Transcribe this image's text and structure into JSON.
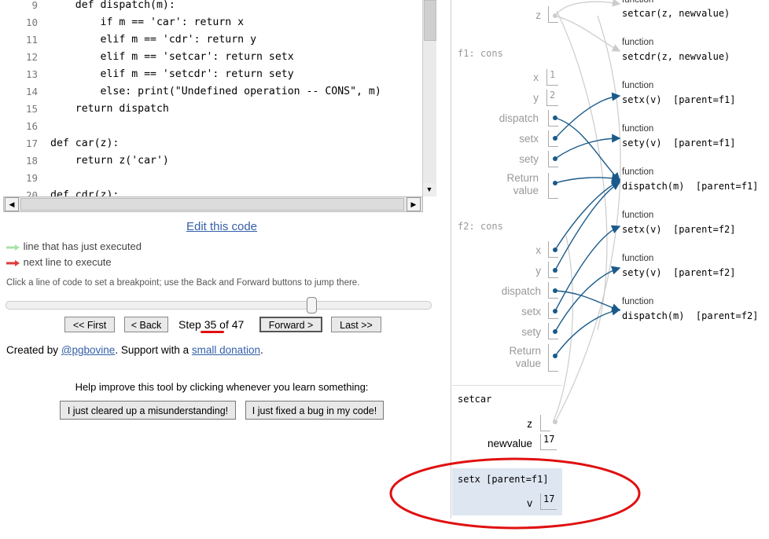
{
  "code": {
    "lines": [
      {
        "num": "9",
        "text": "    def dispatch(m):"
      },
      {
        "num": "10",
        "text": "        if m == 'car': return x"
      },
      {
        "num": "11",
        "text": "        elif m == 'cdr': return y"
      },
      {
        "num": "12",
        "text": "        elif m == 'setcar': return setx"
      },
      {
        "num": "13",
        "text": "        elif m == 'setcdr': return sety"
      },
      {
        "num": "14",
        "text": "        else: print(\"Undefined operation -- CONS\", m)"
      },
      {
        "num": "15",
        "text": "    return dispatch"
      },
      {
        "num": "16",
        "text": ""
      },
      {
        "num": "17",
        "text": "def car(z):"
      },
      {
        "num": "18",
        "text": "    return z('car')"
      },
      {
        "num": "19",
        "text": ""
      },
      {
        "num": "20",
        "text": "def cdr(z):"
      }
    ]
  },
  "edit_link": "Edit this code",
  "legend": {
    "executed": "line that has just executed",
    "next": "next line to execute"
  },
  "hint": "Click a line of code to set a breakpoint; use the Back and Forward buttons to jump there.",
  "slider": {
    "value": 35,
    "max": 47
  },
  "nav": {
    "first": "<< First",
    "back": "< Back",
    "forward": "Forward >",
    "last": "Last >>",
    "step_prefix": "Step",
    "step_current": "35",
    "step_of": "of 47"
  },
  "credits": {
    "prefix": "Created by",
    "author": "@pgbovine",
    "middle": ". Support with a",
    "donation": "small donation",
    "suffix": "."
  },
  "help": {
    "text": "Help improve this tool by clicking whenever you learn something:",
    "misunderstanding": "I just cleared up a misunderstanding!",
    "bug": "I just fixed a bug in my code!"
  },
  "viz": {
    "top_var": "z",
    "top_functions": [
      {
        "label": "function",
        "sig": "setcar(z, newvalue)"
      },
      {
        "label": "function",
        "sig": "setcdr(z, newvalue)"
      }
    ],
    "f1": {
      "title": "f1: cons",
      "x_name": "x",
      "x_val": "1",
      "y_name": "y",
      "y_val": "2",
      "dispatch": "dispatch",
      "setx": "setx",
      "sety": "sety",
      "return_1": "Return",
      "return_2": "value"
    },
    "f1_functions": [
      {
        "label": "function",
        "sig": "setx(v)  [parent=f1]"
      },
      {
        "label": "function",
        "sig": "sety(v)  [parent=f1]"
      },
      {
        "label": "function",
        "sig": "dispatch(m)  [parent=f1]"
      }
    ],
    "f2": {
      "title": "f2: cons",
      "x_name": "x",
      "y_name": "y",
      "dispatch": "dispatch",
      "setx": "setx",
      "sety": "sety",
      "return_1": "Return",
      "return_2": "value"
    },
    "f2_functions": [
      {
        "label": "function",
        "sig": "setx(v)  [parent=f2]"
      },
      {
        "label": "function",
        "sig": "sety(v)  [parent=f2]"
      },
      {
        "label": "function",
        "sig": "dispatch(m)  [parent=f2]"
      }
    ],
    "setcar": {
      "title": "setcar",
      "z_name": "z",
      "newvalue_name": "newvalue",
      "newvalue_val": "17"
    },
    "setx": {
      "title": "setx [parent=f1]",
      "v_name": "v",
      "v_val": "17"
    },
    "colors": {
      "arrow": "#1a5a8a",
      "arrow_gray": "#cccccc",
      "highlight_frame": "#dde6f1",
      "annotation_red": "#e01010"
    }
  }
}
